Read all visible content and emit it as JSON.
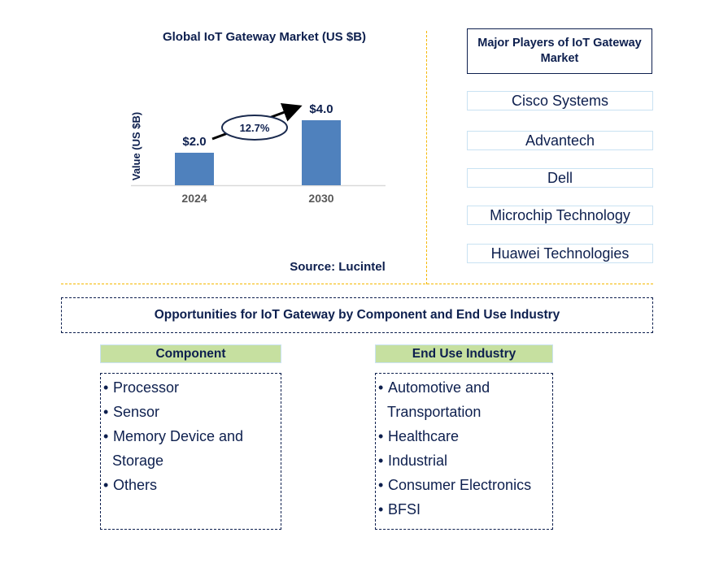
{
  "chart_data": {
    "type": "bar",
    "title": "Global IoT Gateway Market (US $B)",
    "categories": [
      "2024",
      "2030"
    ],
    "values": [
      2.0,
      4.0
    ],
    "data_labels": [
      "$2.0",
      "$4.0"
    ],
    "xlabel": "",
    "ylabel": "Value (US $B)",
    "ylim": [
      0,
      5
    ],
    "grid": false,
    "legend": "none",
    "annotations": [
      {
        "type": "cagr-arrow",
        "text": "12.7%",
        "from": "2024",
        "to": "2030"
      }
    ],
    "bar_color": "#4f81bd"
  },
  "source": "Source: Lucintel",
  "players": {
    "header": "Major Players of IoT Gateway Market",
    "items": [
      "Cisco Systems",
      "Advantech",
      "Dell",
      "Microchip Technology",
      "Huawei Technologies"
    ]
  },
  "opportunities": {
    "title": "Opportunities for IoT Gateway by Component and End Use Industry",
    "segments": [
      {
        "header": "Component",
        "items": [
          {
            "lines": [
              "Processor"
            ]
          },
          {
            "lines": [
              "Sensor"
            ]
          },
          {
            "lines": [
              "Memory Device and",
              "Storage"
            ]
          },
          {
            "lines": [
              "Others"
            ]
          }
        ]
      },
      {
        "header": "End Use Industry",
        "items": [
          {
            "lines": [
              "Automotive and",
              "Transportation"
            ]
          },
          {
            "lines": [
              "Healthcare"
            ]
          },
          {
            "lines": [
              "Industrial"
            ]
          },
          {
            "lines": [
              "Consumer Electronics"
            ]
          },
          {
            "lines": [
              "BFSI"
            ]
          }
        ]
      }
    ]
  },
  "colors": {
    "navy": "#0d1f4e",
    "bar": "#4f81bd",
    "divider": "#f5b800",
    "segment_header_bg": "#c6e0a0",
    "player_border": "#c9e2f2"
  }
}
